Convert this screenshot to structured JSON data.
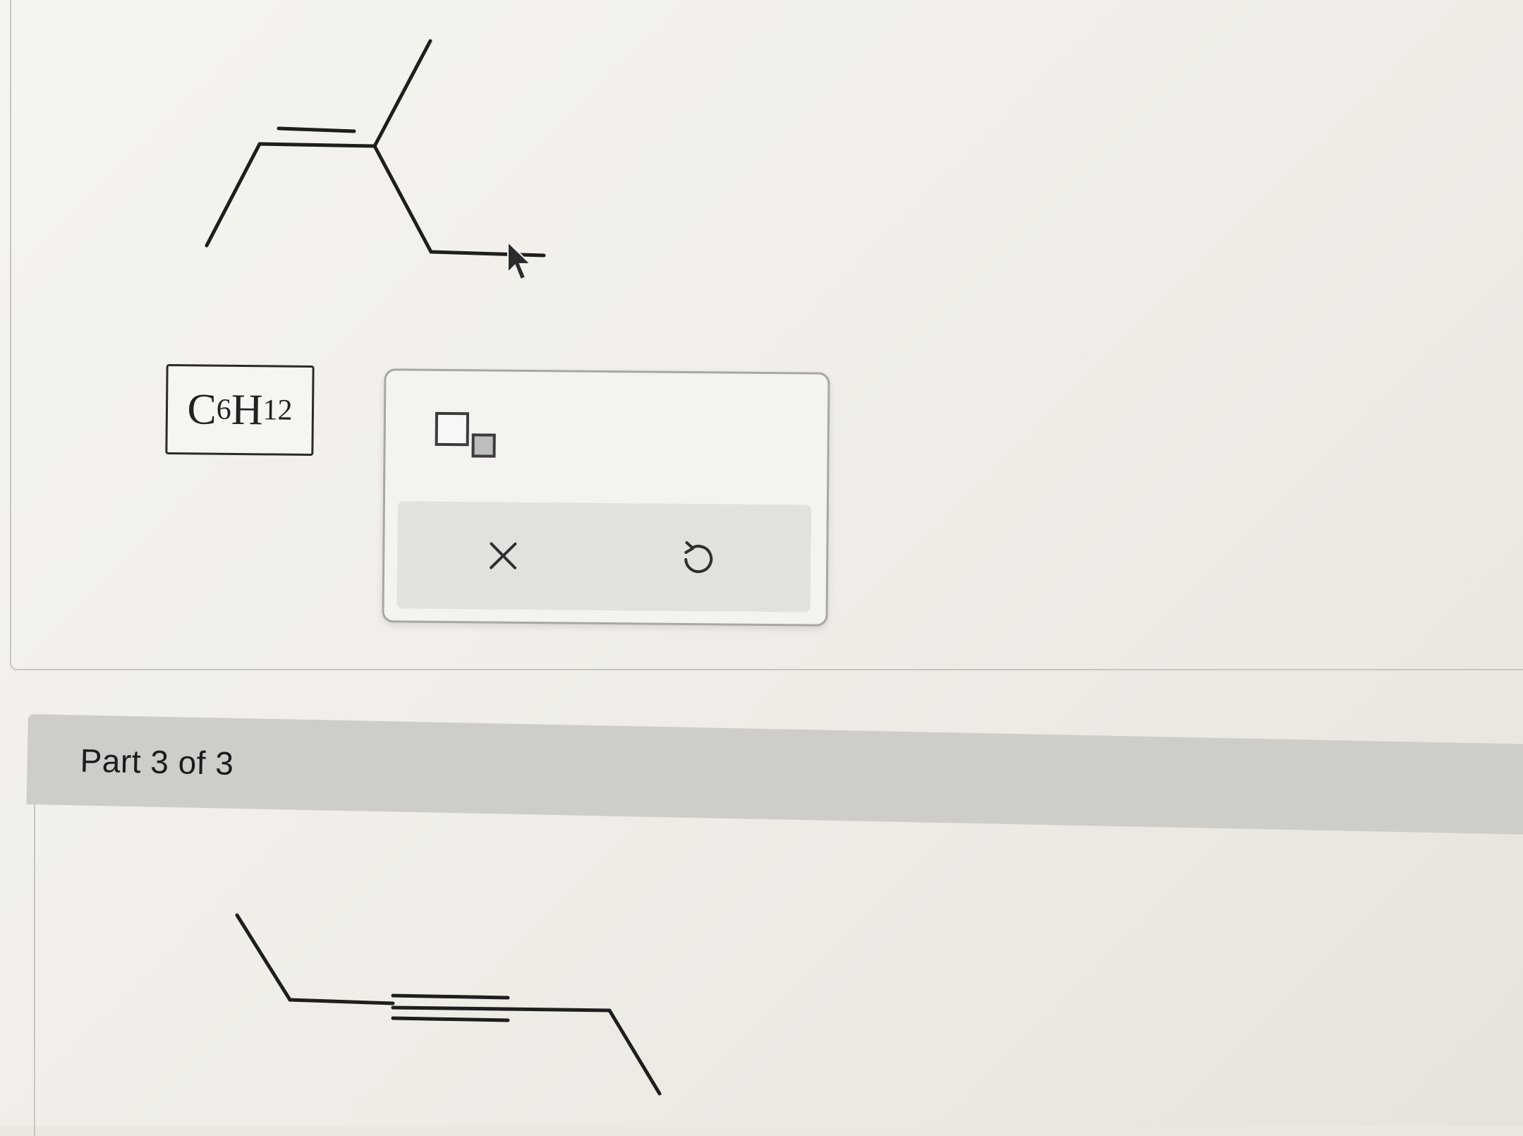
{
  "formula": {
    "element1": "C",
    "sub1": "6",
    "element2": "H",
    "sub2": "12"
  },
  "answer_toolbar": {
    "template_icon": "subscript-template-icon",
    "clear_icon": "close-icon",
    "undo_icon": "undo-icon"
  },
  "part3": {
    "label": "Part 3 of 3"
  },
  "colors": {
    "bond": "#1e1e1e",
    "header": "#cfcdc9",
    "action_bar": "#e2e1dd"
  }
}
